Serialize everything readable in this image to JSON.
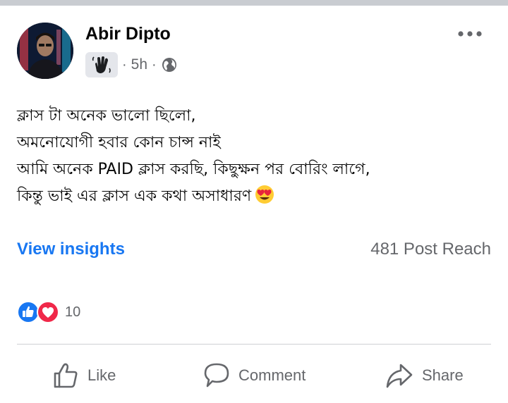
{
  "post": {
    "author": "Abir Dipto",
    "time": "5h",
    "separator": "·",
    "privacy_icon": "globe-icon",
    "badge_icon": "hand-wave-icon",
    "lines": [
      "ক্লাস টা অনেক ভালো ছিলো,",
      "অমনোযোগী হবার কোন চান্স নাই",
      "আমি অনেক PAID ক্লাস করছি, কিছুক্ষন পর বোরিং লাগে,",
      "কিন্তু ভাই এর ক্লাস এক কথা অসাধারণ"
    ],
    "trailing_emoji": "heart-eyes-emoji"
  },
  "insights": {
    "link_label": "View insights",
    "reach": "481 Post Reach"
  },
  "reactions": {
    "types": [
      "like",
      "love"
    ],
    "count": "10"
  },
  "actions": {
    "like": "Like",
    "comment": "Comment",
    "share": "Share"
  },
  "colors": {
    "accent": "#1877f2",
    "secondary_text": "#65676b",
    "like": "#1877f2",
    "love": "#f02849"
  }
}
